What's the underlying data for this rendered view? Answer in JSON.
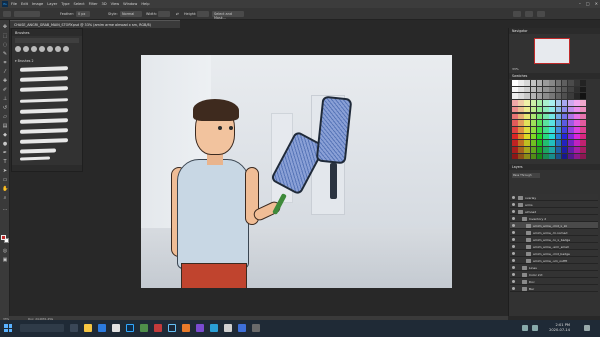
{
  "app": {
    "logo_text": "Ps",
    "menu": [
      "File",
      "Edit",
      "Image",
      "Layer",
      "Type",
      "Select",
      "Filter",
      "3D",
      "View",
      "Window",
      "Help"
    ]
  },
  "options_bar": {
    "feather_label": "Feather:",
    "feather_value": "0 px",
    "style_label": "Style:",
    "style_value": "Normal",
    "width_label": "Width:",
    "height_label": "Height:",
    "select_mask_button": "Select and Mask..."
  },
  "document": {
    "tab_title": "CHASE_ANGRI_GRAB_MAIN_STORY.psd @ 33% (amim arme almoad x sm, RGB/8)"
  },
  "brushes_panel": {
    "title": "Brushes",
    "group_name": "Brushes 2"
  },
  "right_dock": {
    "navigator_title": "Navigator",
    "zoom_value": "33%",
    "swatches_title": "Swatches",
    "layers_title": "Layers",
    "blend_mode": "Pass Through",
    "layer_names": [
      "overlay",
      "arms",
      "almoad",
      "Inventory 2",
      "amim_arme_.mid_x_lol",
      "amim_arme_.hi.nomad",
      "amim_arme_.lo_x_badge",
      "amim_arme_.arm_small",
      "amim_arme_.mid_badge",
      "amim_arme_.sm_outfit",
      "Lines",
      "Color 2ct",
      "Doc",
      "Bar"
    ],
    "selected_layer_index": 4
  },
  "status_bar": {
    "zoom": "33%",
    "doc_size": "Doc: 24.0M/1.25G"
  },
  "taskbar": {
    "time": "2:01 PM",
    "date": "2020-07-14"
  },
  "colors": {
    "accent": "#31a8ff",
    "foreground_color": "#c02a2a",
    "background_color": "#ffffff"
  },
  "toolbar_icons": [
    "move-icon",
    "marquee-icon",
    "lasso-icon",
    "quick-select-icon",
    "crop-icon",
    "eyedropper-icon",
    "healing-icon",
    "brush-icon",
    "stamp-icon",
    "history-brush-icon",
    "eraser-icon",
    "gradient-icon",
    "blur-icon",
    "dodge-icon",
    "pen-icon",
    "type-icon",
    "path-select-icon",
    "shape-icon",
    "hand-icon",
    "zoom-icon"
  ]
}
